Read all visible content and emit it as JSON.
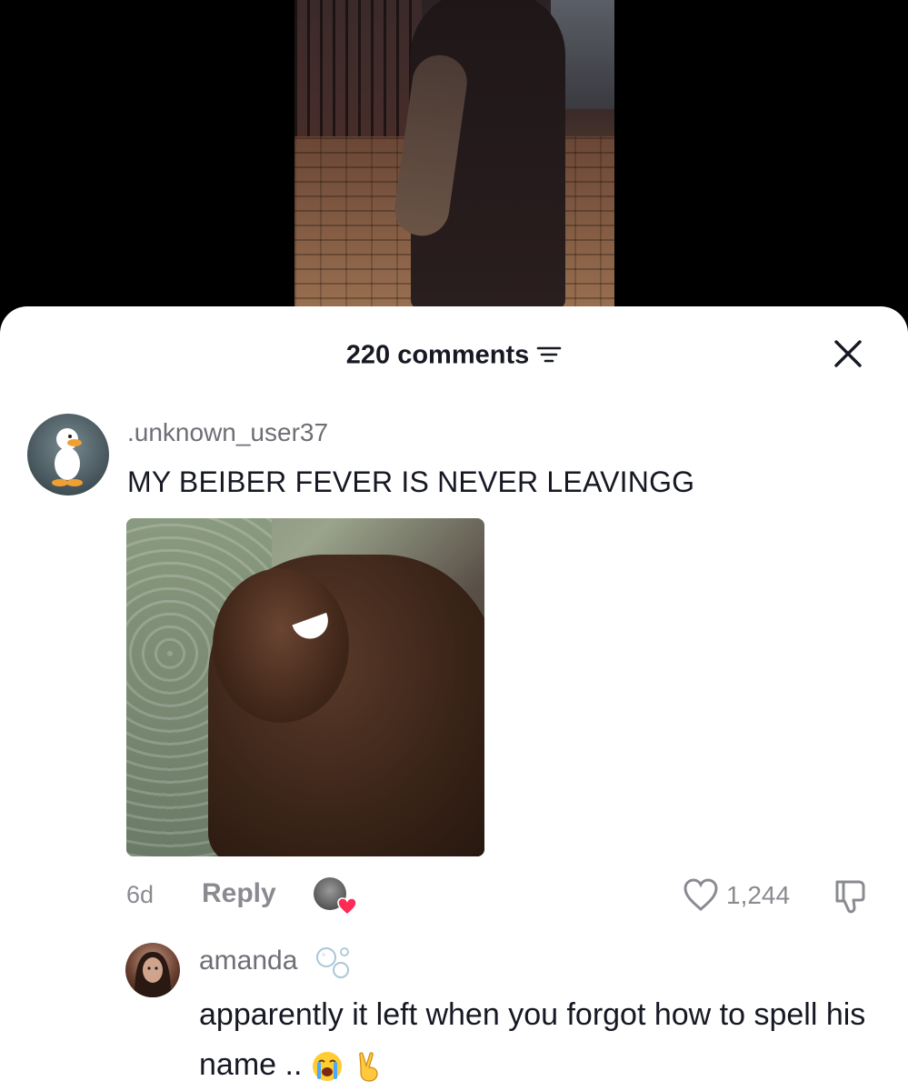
{
  "header": {
    "comment_count": "220 comments"
  },
  "comments": [
    {
      "username": ".unknown_user37",
      "text": "MY BEIBER FEVER IS NEVER LEAVINGG",
      "time": "6d",
      "reply_label": "Reply",
      "likes": "1,244",
      "avatar_icon": "duck-avatar",
      "has_image": true,
      "creator_liked": true
    }
  ],
  "reply": {
    "username": "amanda",
    "username_badge_icon": "bubbles-icon",
    "text": "apparently it left when you forgot how to spell his name ..",
    "trailing_emojis": [
      "loudly-crying-face",
      "victory-hand"
    ]
  },
  "colors": {
    "primary_text": "#161823",
    "secondary_text": "#8a8b91",
    "heart_accent": "#fe2c55"
  }
}
